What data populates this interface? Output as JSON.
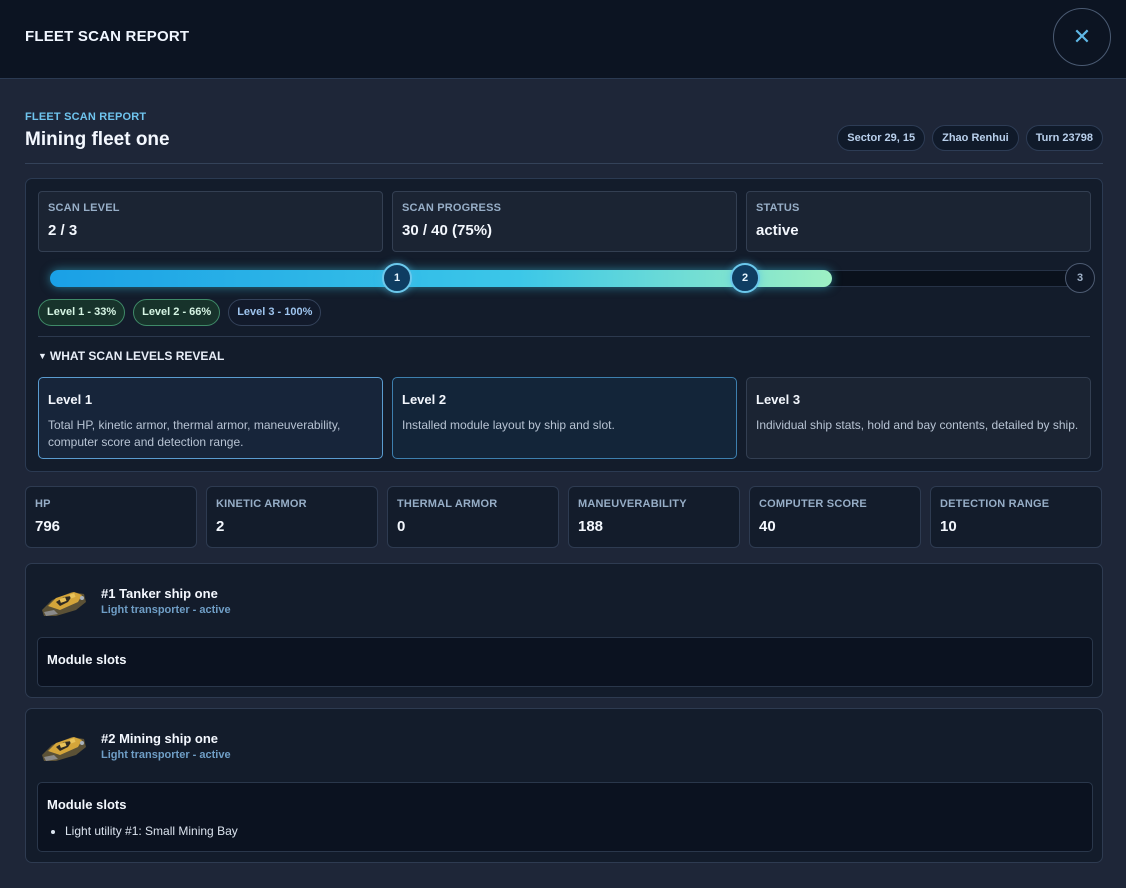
{
  "window": {
    "title": "FLEET SCAN REPORT",
    "close_icon": "close-icon"
  },
  "header": {
    "eyebrow": "FLEET SCAN REPORT",
    "fleet_name": "Mining fleet one",
    "chips": [
      "Sector 29, 15",
      "Zhao Renhui",
      "Turn 23798"
    ]
  },
  "scan": {
    "cards": [
      {
        "label": "SCAN LEVEL",
        "value": "2 / 3"
      },
      {
        "label": "SCAN PROGRESS",
        "value": "30 / 40 (75%)"
      },
      {
        "label": "STATUS",
        "value": "active"
      }
    ],
    "progress_fraction": 0.75,
    "markers": [
      {
        "label": "1",
        "position_fraction": 0.333,
        "reached": true
      },
      {
        "label": "2",
        "position_fraction": 0.666,
        "reached": true
      },
      {
        "label": "3",
        "position_fraction": 1.0,
        "reached": false
      }
    ],
    "level_pills": [
      {
        "label": "Level 1 - 33%",
        "reached": true
      },
      {
        "label": "Level 2 - 66%",
        "reached": true
      },
      {
        "label": "Level 3 - 100%",
        "reached": false
      }
    ],
    "reveal_toggle": "WHAT SCAN LEVELS REVEAL",
    "levels": [
      {
        "title": "Level 1",
        "description": "Total HP, kinetic armor, thermal armor, maneuverability, computer score and detection range."
      },
      {
        "title": "Level 2",
        "description": "Installed module layout by ship and slot."
      },
      {
        "title": "Level 3",
        "description": "Individual ship stats, hold and bay contents, detailed by ship."
      }
    ]
  },
  "stats": [
    {
      "label": "HP",
      "value": "796"
    },
    {
      "label": "KINETIC ARMOR",
      "value": "2"
    },
    {
      "label": "THERMAL ARMOR",
      "value": "0"
    },
    {
      "label": "MANEUVERABILITY",
      "value": "188"
    },
    {
      "label": "COMPUTER SCORE",
      "value": "40"
    },
    {
      "label": "DETECTION RANGE",
      "value": "10"
    }
  ],
  "ships": [
    {
      "name": "#1 Tanker ship one",
      "subtitle": "Light transporter - active",
      "modules_title": "Module slots",
      "modules": []
    },
    {
      "name": "#2 Mining ship one",
      "subtitle": "Light transporter - active",
      "modules_title": "Module slots",
      "modules": [
        "Light utility #1: Small Mining Bay"
      ]
    }
  ],
  "colors": {
    "accent": "#3cc7e8",
    "fill_start": "#1aa0e6",
    "fill_end": "#9ef0c4",
    "background": "#1e2638"
  }
}
